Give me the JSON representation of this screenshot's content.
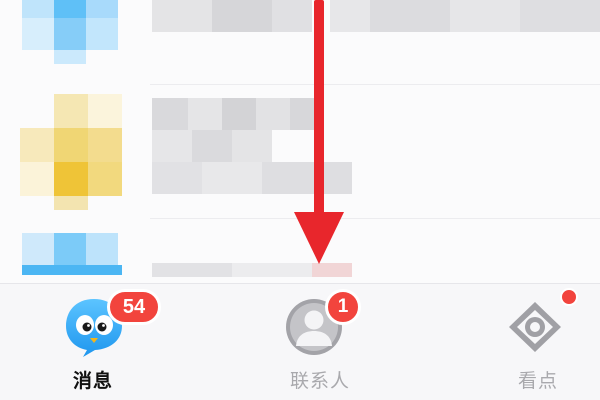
{
  "tabs": {
    "messages": {
      "label": "消息",
      "badge": "54"
    },
    "contacts": {
      "label": "联系人",
      "badge": "1"
    },
    "watch": {
      "label": "看点",
      "has_dot": true
    }
  },
  "icons": {
    "messages": "penguin-chat-icon",
    "contacts": "person-silhouette-icon",
    "watch": "eye-icon"
  },
  "colors": {
    "accent_blue": "#35a8f5",
    "badge_red": "#f2443d",
    "arrow_red": "#e8262c",
    "inactive_gray": "#a9a9ad",
    "active_label": "#111111"
  }
}
